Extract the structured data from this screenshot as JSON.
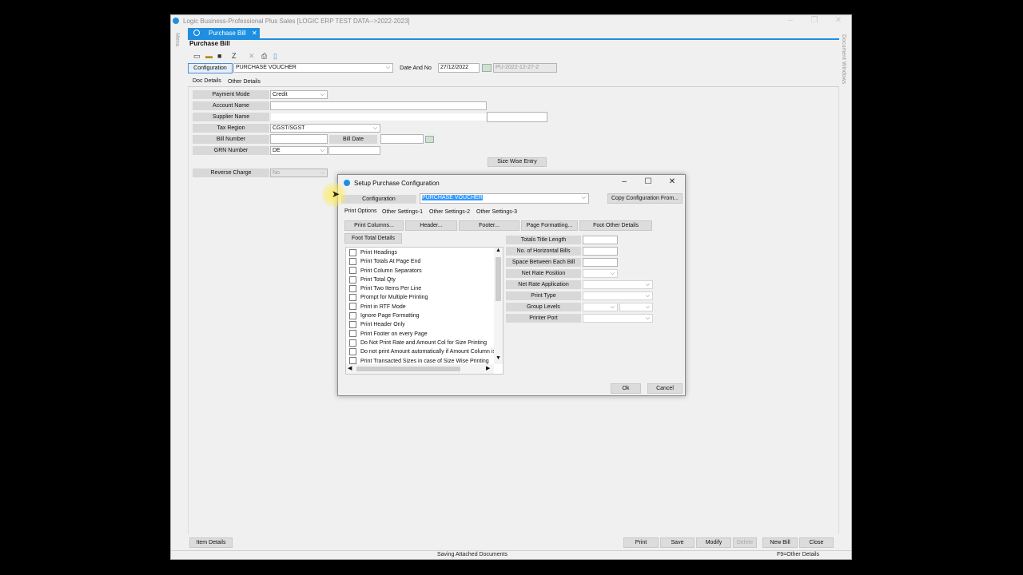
{
  "window": {
    "title": "Logic Business-Professional Plus Sales  [LOGIC ERP TEST DATA-->2022-2023]",
    "controls": [
      "–",
      "❐",
      "✕"
    ]
  },
  "side": {
    "left_label": "Menu",
    "right_label": "Document Windows"
  },
  "doc_tab": {
    "label": "Purchase Bill",
    "close": "✕"
  },
  "form_title": "Purchase Bill",
  "header": {
    "configuration_label": "Configuration",
    "configuration_value": "PURCHASE VOUCHER",
    "date_no_label": "Date And No",
    "date_value": "27/12/2022",
    "doc_number": "PU-2022-12-27-2"
  },
  "tabs": [
    "Doc Details",
    "Other Details"
  ],
  "fields": {
    "payment_mode_label": "Payment Mode",
    "payment_mode_value": "Credit",
    "account_name_label": "Account Name",
    "supplier_name_label": "Supplier Name",
    "tax_region_label": "Tax Region",
    "tax_region_value": "CGST/SGST",
    "bill_number_label": "Bill Number",
    "bill_date_label": "Bill Date",
    "grn_number_label": "GRN Number",
    "grn_number_value": "DE",
    "reverse_charge_label": "Reverse Charge",
    "reverse_charge_value": "No",
    "size_wise_entry": "Size Wise Entry"
  },
  "dialog": {
    "title": "Setup Purchase Configuration",
    "configuration_label": "Configuration",
    "configuration_value": "PURCHASE VOUCHER",
    "copy_button": "Copy Configuration From...",
    "tabs": [
      "Print Options",
      "Other Settings-1",
      "Other Settings-2",
      "Other Settings-3"
    ],
    "section_buttons": [
      "Print Columns...",
      "Header...",
      "Footer...",
      "Page Formatting...",
      "Foot Other Details"
    ],
    "foot_total_button": "Foot Total Details",
    "checkboxes": [
      "Print Headings",
      "Print Totals At Page End",
      "Print Column Separators",
      "Print Total Qty",
      "Print Two Items Per Line",
      "Prompt for Multiple Printing",
      "Print in RTF Mode",
      "Ignore Page Formatting",
      "Print Header Only",
      "Print Footer on every Page",
      "Do Not Print Rate and Amount Col for Size Printing",
      "Do not print Amount automatically if Amount Column is",
      "Print Transacted Sizes in case of Size Wise Printing"
    ],
    "right_labels": [
      "Totals Title Length",
      "No. of Horizontal Bills",
      "Space Between Each Bill",
      "Net Rate Position",
      "Net Rate Application",
      "Print Type",
      "Group Levels",
      "Printer Port"
    ],
    "ok_button": "Ok",
    "cancel_button": "Cancel"
  },
  "bottom": {
    "item_details": "Item Details",
    "print": "Print",
    "save": "Save",
    "modify": "Modify",
    "delete": "Delete",
    "new_bill": "New Bill",
    "close": "Close",
    "status_text": "Saving Attached Documents",
    "hint": "F9=Other Details"
  }
}
